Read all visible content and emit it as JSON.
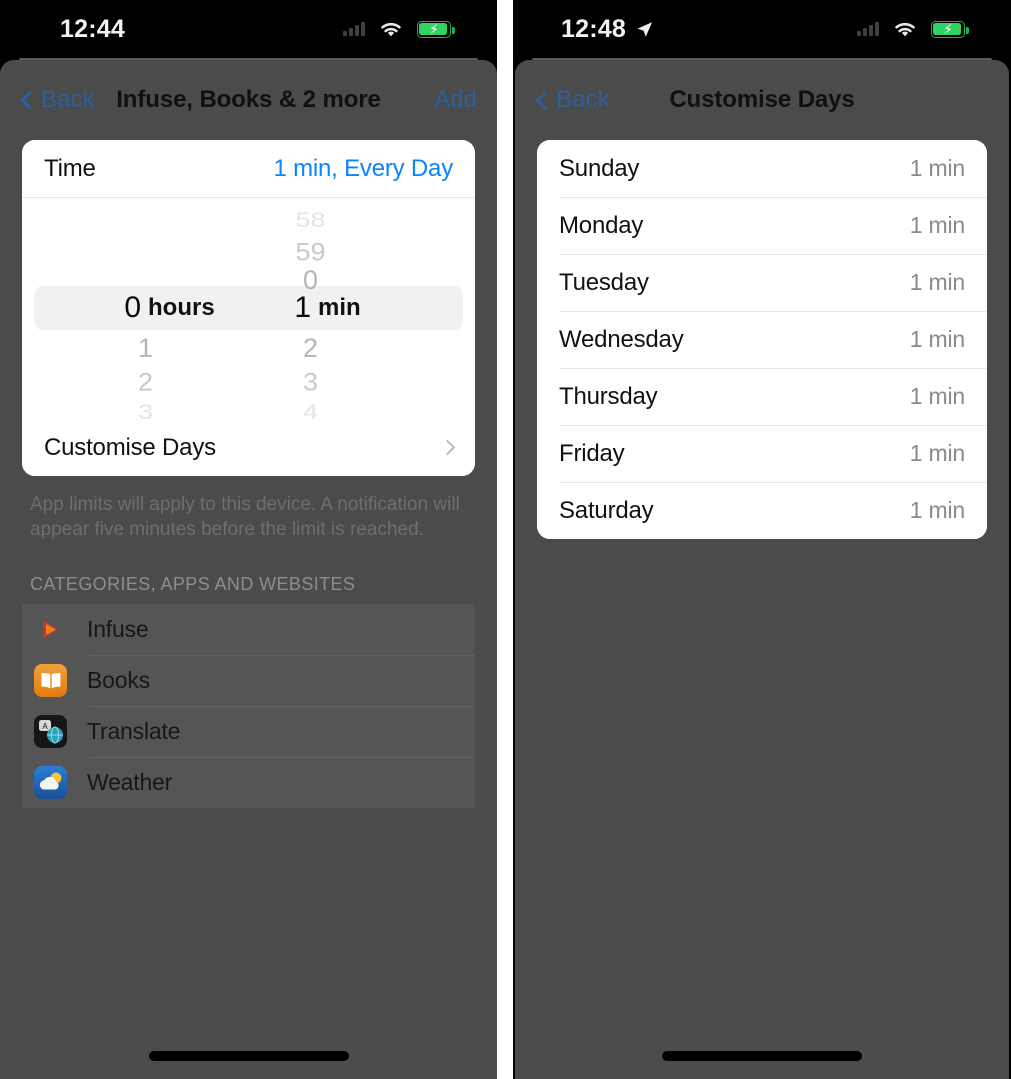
{
  "left_phone": {
    "status_bar": {
      "time": "12:44",
      "signal_icon": "cellular-signal-icon",
      "wifi_icon": "wifi-icon",
      "battery_icon": "battery-charging-icon",
      "battery_bolt": "⚡"
    },
    "nav": {
      "back_label": "Back",
      "back_icon": "chevron-left-icon",
      "title": "Infuse, Books & 2 more",
      "action_label": "Add"
    },
    "time_row": {
      "label": "Time",
      "value": "1 min, Every Day"
    },
    "picker": {
      "hours": {
        "above": [
          "",
          "",
          ""
        ],
        "selected_value": "0",
        "selected_unit": "hours",
        "below": [
          "1",
          "2",
          "3"
        ]
      },
      "minutes": {
        "above": [
          "58",
          "59",
          "0"
        ],
        "selected_value": "1",
        "selected_unit": "min",
        "below": [
          "2",
          "3",
          "4"
        ]
      }
    },
    "customise_row": {
      "label": "Customise Days",
      "chevron_icon": "chevron-right-icon"
    },
    "note": "App limits will apply to this device. A notification will appear five minutes before the limit is reached.",
    "section_header": "CATEGORIES, APPS AND WEBSITES",
    "apps": [
      {
        "name": "Infuse",
        "icon": "infuse-app-icon"
      },
      {
        "name": "Books",
        "icon": "books-app-icon"
      },
      {
        "name": "Translate",
        "icon": "translate-app-icon"
      },
      {
        "name": "Weather",
        "icon": "weather-app-icon"
      }
    ]
  },
  "right_phone": {
    "status_bar": {
      "time": "12:48",
      "location_icon": "location-arrow-icon",
      "signal_icon": "cellular-signal-icon",
      "wifi_icon": "wifi-icon",
      "battery_icon": "battery-charging-icon",
      "battery_bolt": "⚡"
    },
    "nav": {
      "back_label": "Back",
      "back_icon": "chevron-left-icon",
      "title": "Customise Days"
    },
    "days": [
      {
        "day": "Sunday",
        "limit": "1 min"
      },
      {
        "day": "Monday",
        "limit": "1 min"
      },
      {
        "day": "Tuesday",
        "limit": "1 min"
      },
      {
        "day": "Wednesday",
        "limit": "1 min"
      },
      {
        "day": "Thursday",
        "limit": "1 min"
      },
      {
        "day": "Friday",
        "limit": "1 min"
      },
      {
        "day": "Saturday",
        "limit": "1 min"
      }
    ]
  },
  "colors": {
    "accent_blue": "#0a84ff",
    "dim_backdrop": "#4b4b4b",
    "card_white": "#ffffff",
    "battery_green": "#2fd463",
    "secondary_text": "#8a8a8e"
  }
}
